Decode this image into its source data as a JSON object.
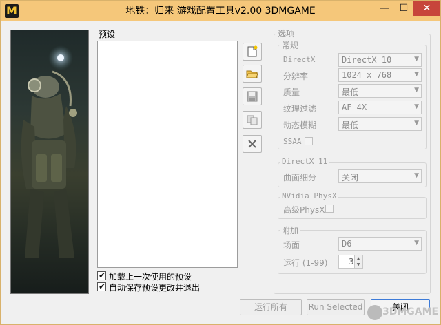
{
  "window": {
    "title": "地铁：归来 游戏配置工具v2.00 3DMGAME",
    "app_icon_letter": "M",
    "min_glyph": "—",
    "max_glyph": "☐",
    "close_glyph": "✕"
  },
  "presets": {
    "label": "预设",
    "toolbar": [
      "new-icon",
      "open-folder-icon",
      "save-icon",
      "copy-icon",
      "delete-icon"
    ],
    "load_last_label": "加载上一次使用的预设",
    "load_last_checked": true,
    "autosave_label": "自动保存预设更改并退出",
    "autosave_checked": true
  },
  "options": {
    "title": "选项",
    "general": {
      "title": "常规",
      "directx_label": "DirectX",
      "directx_value": "DirectX 10",
      "resolution_label": "分辨率",
      "resolution_value": "1024 x 768",
      "quality_label": "质量",
      "quality_value": "最低",
      "texture_filter_label": "纹理过滤",
      "texture_filter_value": "AF 4X",
      "motion_blur_label": "动态模糊",
      "motion_blur_value": "最低",
      "ssaa_label": "SSAA"
    },
    "dx11": {
      "title": "DirectX 11",
      "tessellation_label": "曲面细分",
      "tessellation_value": "关闭"
    },
    "physx": {
      "title": "NVidia PhysX",
      "advanced_label": "高级PhysX"
    },
    "extra": {
      "title": "附加",
      "scene_label": "场面",
      "scene_value": "D6",
      "runs_label": "运行 (1-99)",
      "runs_value": "3"
    }
  },
  "footer": {
    "run_all": "运行所有",
    "run_selected": "Run Selected",
    "close": "关闭"
  },
  "watermark": {
    "text": "3DMGAME"
  },
  "colors": {
    "titlebar": "#f5c77a",
    "close_button": "#c7453b",
    "focus_border": "#3d7bd8"
  }
}
